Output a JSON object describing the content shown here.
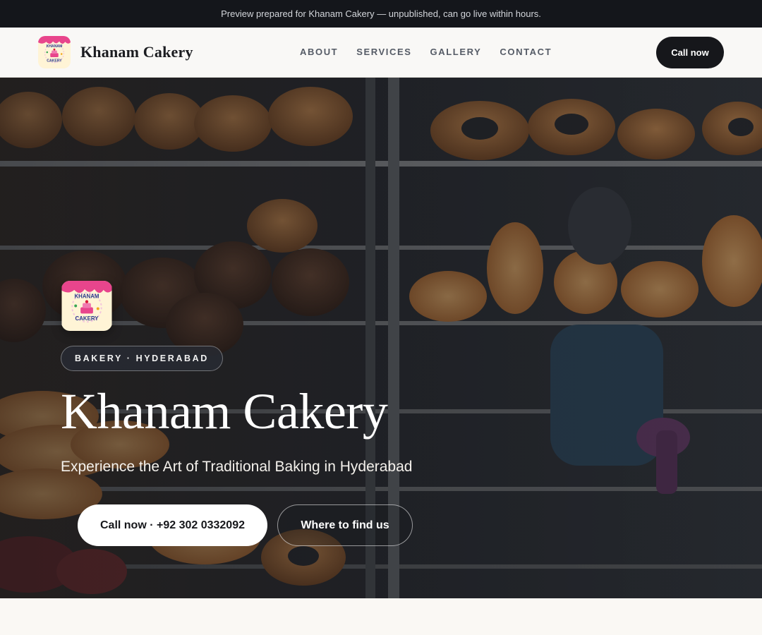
{
  "preview_notice": "Preview prepared for Khanam Cakery — unpublished, can go live within hours.",
  "header": {
    "brand_name": "Khanam Cakery",
    "logo_icon": "khanam-cakery-logo",
    "nav": [
      "ABOUT",
      "SERVICES",
      "GALLERY",
      "CONTACT"
    ],
    "cta_label": "Call now"
  },
  "hero": {
    "background_icon": "bakery-shelves-photo",
    "badge": "BAKERY · HYDERABAD",
    "title": "Khanam Cakery",
    "subtitle": "Experience the Art of Traditional Baking in Hyderabad",
    "primary_button": "Call now · +92 302 0332092",
    "secondary_button": "Where to find us"
  },
  "colors": {
    "dark": "#16171b",
    "background": "#faf8f4",
    "logo_pink": "#e8458c",
    "logo_cream": "#fff4d6"
  }
}
